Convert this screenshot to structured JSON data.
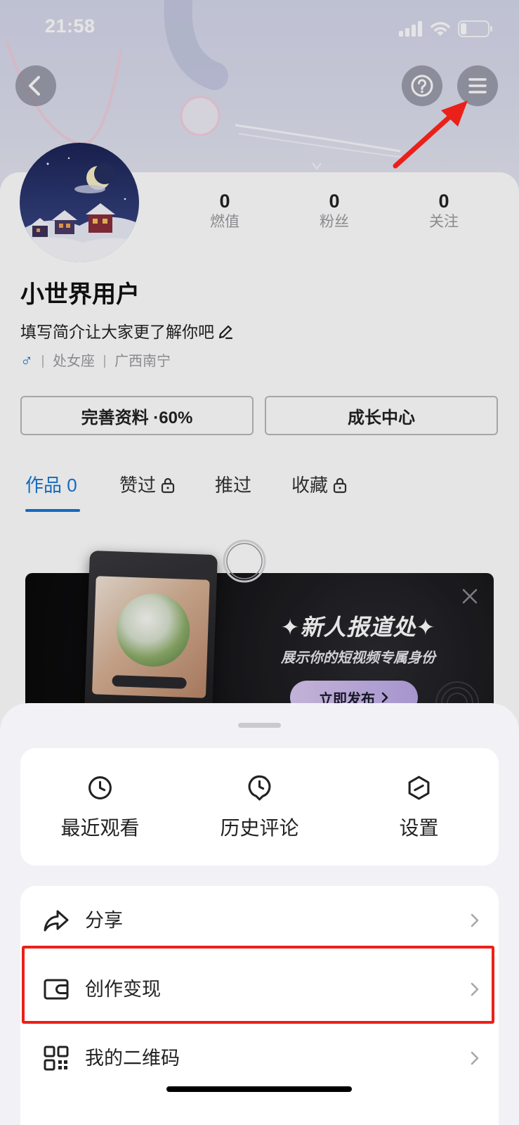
{
  "status_bar": {
    "time": "21:58",
    "battery_level": 0.22
  },
  "nav": {
    "back_icon": "back-icon",
    "help_icon": "help-icon",
    "menu_icon": "menu-icon"
  },
  "profile": {
    "name": "小世界用户",
    "bio": "填写简介让大家更了解你吧",
    "gender": "♂",
    "zodiac": "处女座",
    "location": "广西南宁",
    "stats": [
      {
        "value": "0",
        "label": "燃值"
      },
      {
        "value": "0",
        "label": "粉丝"
      },
      {
        "value": "0",
        "label": "关注"
      }
    ],
    "complete_profile_button": "完善资料 ·60%",
    "growth_center_button": "成长中心"
  },
  "tabs": [
    {
      "label": "作品 0",
      "active": true,
      "locked": false
    },
    {
      "label": "赞过",
      "active": false,
      "locked": true
    },
    {
      "label": "推过",
      "active": false,
      "locked": false
    },
    {
      "label": "收藏",
      "active": false,
      "locked": true
    }
  ],
  "banner": {
    "title": "✦新人报道处✦",
    "subtitle": "展示你的短视频专属身份",
    "cta": "立即发布"
  },
  "sheet": {
    "quick_actions": [
      {
        "label": "最近观看",
        "icon": "clock-icon"
      },
      {
        "label": "历史评论",
        "icon": "comment-history-icon"
      },
      {
        "label": "设置",
        "icon": "settings-icon"
      }
    ],
    "menu": [
      {
        "label": "分享",
        "icon": "share-icon"
      },
      {
        "label": "创作变现",
        "icon": "wallet-icon",
        "highlighted": true
      },
      {
        "label": "我的二维码",
        "icon": "qr-code-icon"
      }
    ]
  },
  "colors": {
    "accent": "#1677d2",
    "annotation_red": "#ea2119",
    "sheet_background": "#f2f2f6"
  }
}
